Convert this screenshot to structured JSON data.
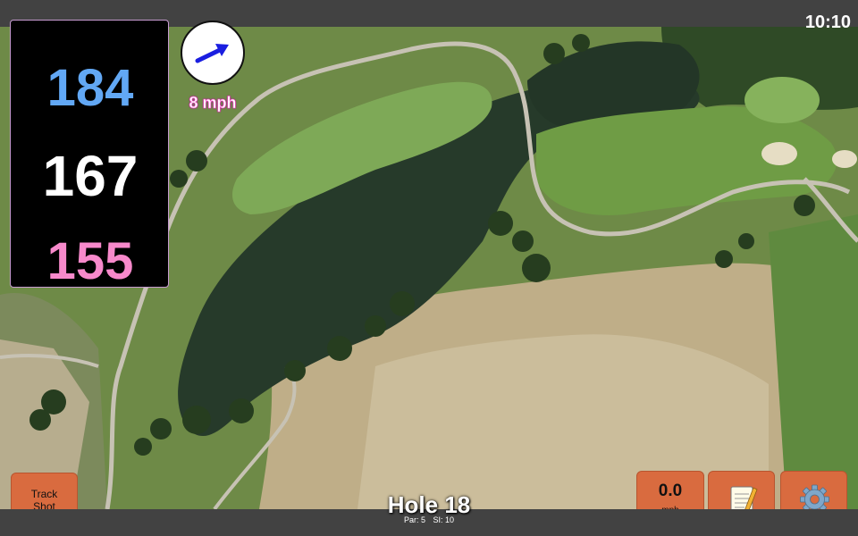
{
  "status": {
    "time": "10:10"
  },
  "distances": {
    "back": "184",
    "center": "167",
    "front": "155",
    "colors": {
      "back": "#62a8f5",
      "center": "#ffffff",
      "front": "#f789cb"
    }
  },
  "wind": {
    "speed_label": "8 mph",
    "arrow_icon": "wind-arrow-icon",
    "arrow_color": "#1a1ee0"
  },
  "hole": {
    "title": "Hole 18",
    "par_label": "Par: 5",
    "si_label": "SI: 10"
  },
  "buttons": {
    "track_shot": "Track\nShot",
    "speed_value": "0.0",
    "speed_unit": "mph",
    "notes_icon": "notepad-icon",
    "settings_icon": "gear-icon",
    "accent": "#d96b3f"
  }
}
